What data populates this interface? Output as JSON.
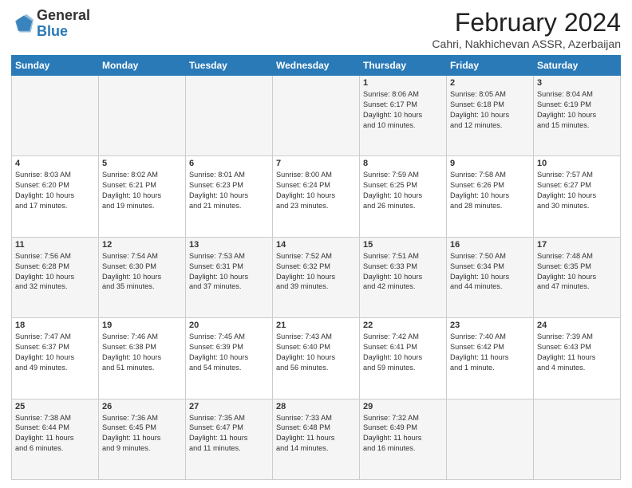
{
  "header": {
    "logo_general": "General",
    "logo_blue": "Blue",
    "month_year": "February 2024",
    "location": "Cahri, Nakhichevan ASSR, Azerbaijan"
  },
  "weekdays": [
    "Sunday",
    "Monday",
    "Tuesday",
    "Wednesday",
    "Thursday",
    "Friday",
    "Saturday"
  ],
  "weeks": [
    [
      {
        "day": "",
        "info": ""
      },
      {
        "day": "",
        "info": ""
      },
      {
        "day": "",
        "info": ""
      },
      {
        "day": "",
        "info": ""
      },
      {
        "day": "1",
        "info": "Sunrise: 8:06 AM\nSunset: 6:17 PM\nDaylight: 10 hours\nand 10 minutes."
      },
      {
        "day": "2",
        "info": "Sunrise: 8:05 AM\nSunset: 6:18 PM\nDaylight: 10 hours\nand 12 minutes."
      },
      {
        "day": "3",
        "info": "Sunrise: 8:04 AM\nSunset: 6:19 PM\nDaylight: 10 hours\nand 15 minutes."
      }
    ],
    [
      {
        "day": "4",
        "info": "Sunrise: 8:03 AM\nSunset: 6:20 PM\nDaylight: 10 hours\nand 17 minutes."
      },
      {
        "day": "5",
        "info": "Sunrise: 8:02 AM\nSunset: 6:21 PM\nDaylight: 10 hours\nand 19 minutes."
      },
      {
        "day": "6",
        "info": "Sunrise: 8:01 AM\nSunset: 6:23 PM\nDaylight: 10 hours\nand 21 minutes."
      },
      {
        "day": "7",
        "info": "Sunrise: 8:00 AM\nSunset: 6:24 PM\nDaylight: 10 hours\nand 23 minutes."
      },
      {
        "day": "8",
        "info": "Sunrise: 7:59 AM\nSunset: 6:25 PM\nDaylight: 10 hours\nand 26 minutes."
      },
      {
        "day": "9",
        "info": "Sunrise: 7:58 AM\nSunset: 6:26 PM\nDaylight: 10 hours\nand 28 minutes."
      },
      {
        "day": "10",
        "info": "Sunrise: 7:57 AM\nSunset: 6:27 PM\nDaylight: 10 hours\nand 30 minutes."
      }
    ],
    [
      {
        "day": "11",
        "info": "Sunrise: 7:56 AM\nSunset: 6:28 PM\nDaylight: 10 hours\nand 32 minutes."
      },
      {
        "day": "12",
        "info": "Sunrise: 7:54 AM\nSunset: 6:30 PM\nDaylight: 10 hours\nand 35 minutes."
      },
      {
        "day": "13",
        "info": "Sunrise: 7:53 AM\nSunset: 6:31 PM\nDaylight: 10 hours\nand 37 minutes."
      },
      {
        "day": "14",
        "info": "Sunrise: 7:52 AM\nSunset: 6:32 PM\nDaylight: 10 hours\nand 39 minutes."
      },
      {
        "day": "15",
        "info": "Sunrise: 7:51 AM\nSunset: 6:33 PM\nDaylight: 10 hours\nand 42 minutes."
      },
      {
        "day": "16",
        "info": "Sunrise: 7:50 AM\nSunset: 6:34 PM\nDaylight: 10 hours\nand 44 minutes."
      },
      {
        "day": "17",
        "info": "Sunrise: 7:48 AM\nSunset: 6:35 PM\nDaylight: 10 hours\nand 47 minutes."
      }
    ],
    [
      {
        "day": "18",
        "info": "Sunrise: 7:47 AM\nSunset: 6:37 PM\nDaylight: 10 hours\nand 49 minutes."
      },
      {
        "day": "19",
        "info": "Sunrise: 7:46 AM\nSunset: 6:38 PM\nDaylight: 10 hours\nand 51 minutes."
      },
      {
        "day": "20",
        "info": "Sunrise: 7:45 AM\nSunset: 6:39 PM\nDaylight: 10 hours\nand 54 minutes."
      },
      {
        "day": "21",
        "info": "Sunrise: 7:43 AM\nSunset: 6:40 PM\nDaylight: 10 hours\nand 56 minutes."
      },
      {
        "day": "22",
        "info": "Sunrise: 7:42 AM\nSunset: 6:41 PM\nDaylight: 10 hours\nand 59 minutes."
      },
      {
        "day": "23",
        "info": "Sunrise: 7:40 AM\nSunset: 6:42 PM\nDaylight: 11 hours\nand 1 minute."
      },
      {
        "day": "24",
        "info": "Sunrise: 7:39 AM\nSunset: 6:43 PM\nDaylight: 11 hours\nand 4 minutes."
      }
    ],
    [
      {
        "day": "25",
        "info": "Sunrise: 7:38 AM\nSunset: 6:44 PM\nDaylight: 11 hours\nand 6 minutes."
      },
      {
        "day": "26",
        "info": "Sunrise: 7:36 AM\nSunset: 6:45 PM\nDaylight: 11 hours\nand 9 minutes."
      },
      {
        "day": "27",
        "info": "Sunrise: 7:35 AM\nSunset: 6:47 PM\nDaylight: 11 hours\nand 11 minutes."
      },
      {
        "day": "28",
        "info": "Sunrise: 7:33 AM\nSunset: 6:48 PM\nDaylight: 11 hours\nand 14 minutes."
      },
      {
        "day": "29",
        "info": "Sunrise: 7:32 AM\nSunset: 6:49 PM\nDaylight: 11 hours\nand 16 minutes."
      },
      {
        "day": "",
        "info": ""
      },
      {
        "day": "",
        "info": ""
      }
    ]
  ]
}
